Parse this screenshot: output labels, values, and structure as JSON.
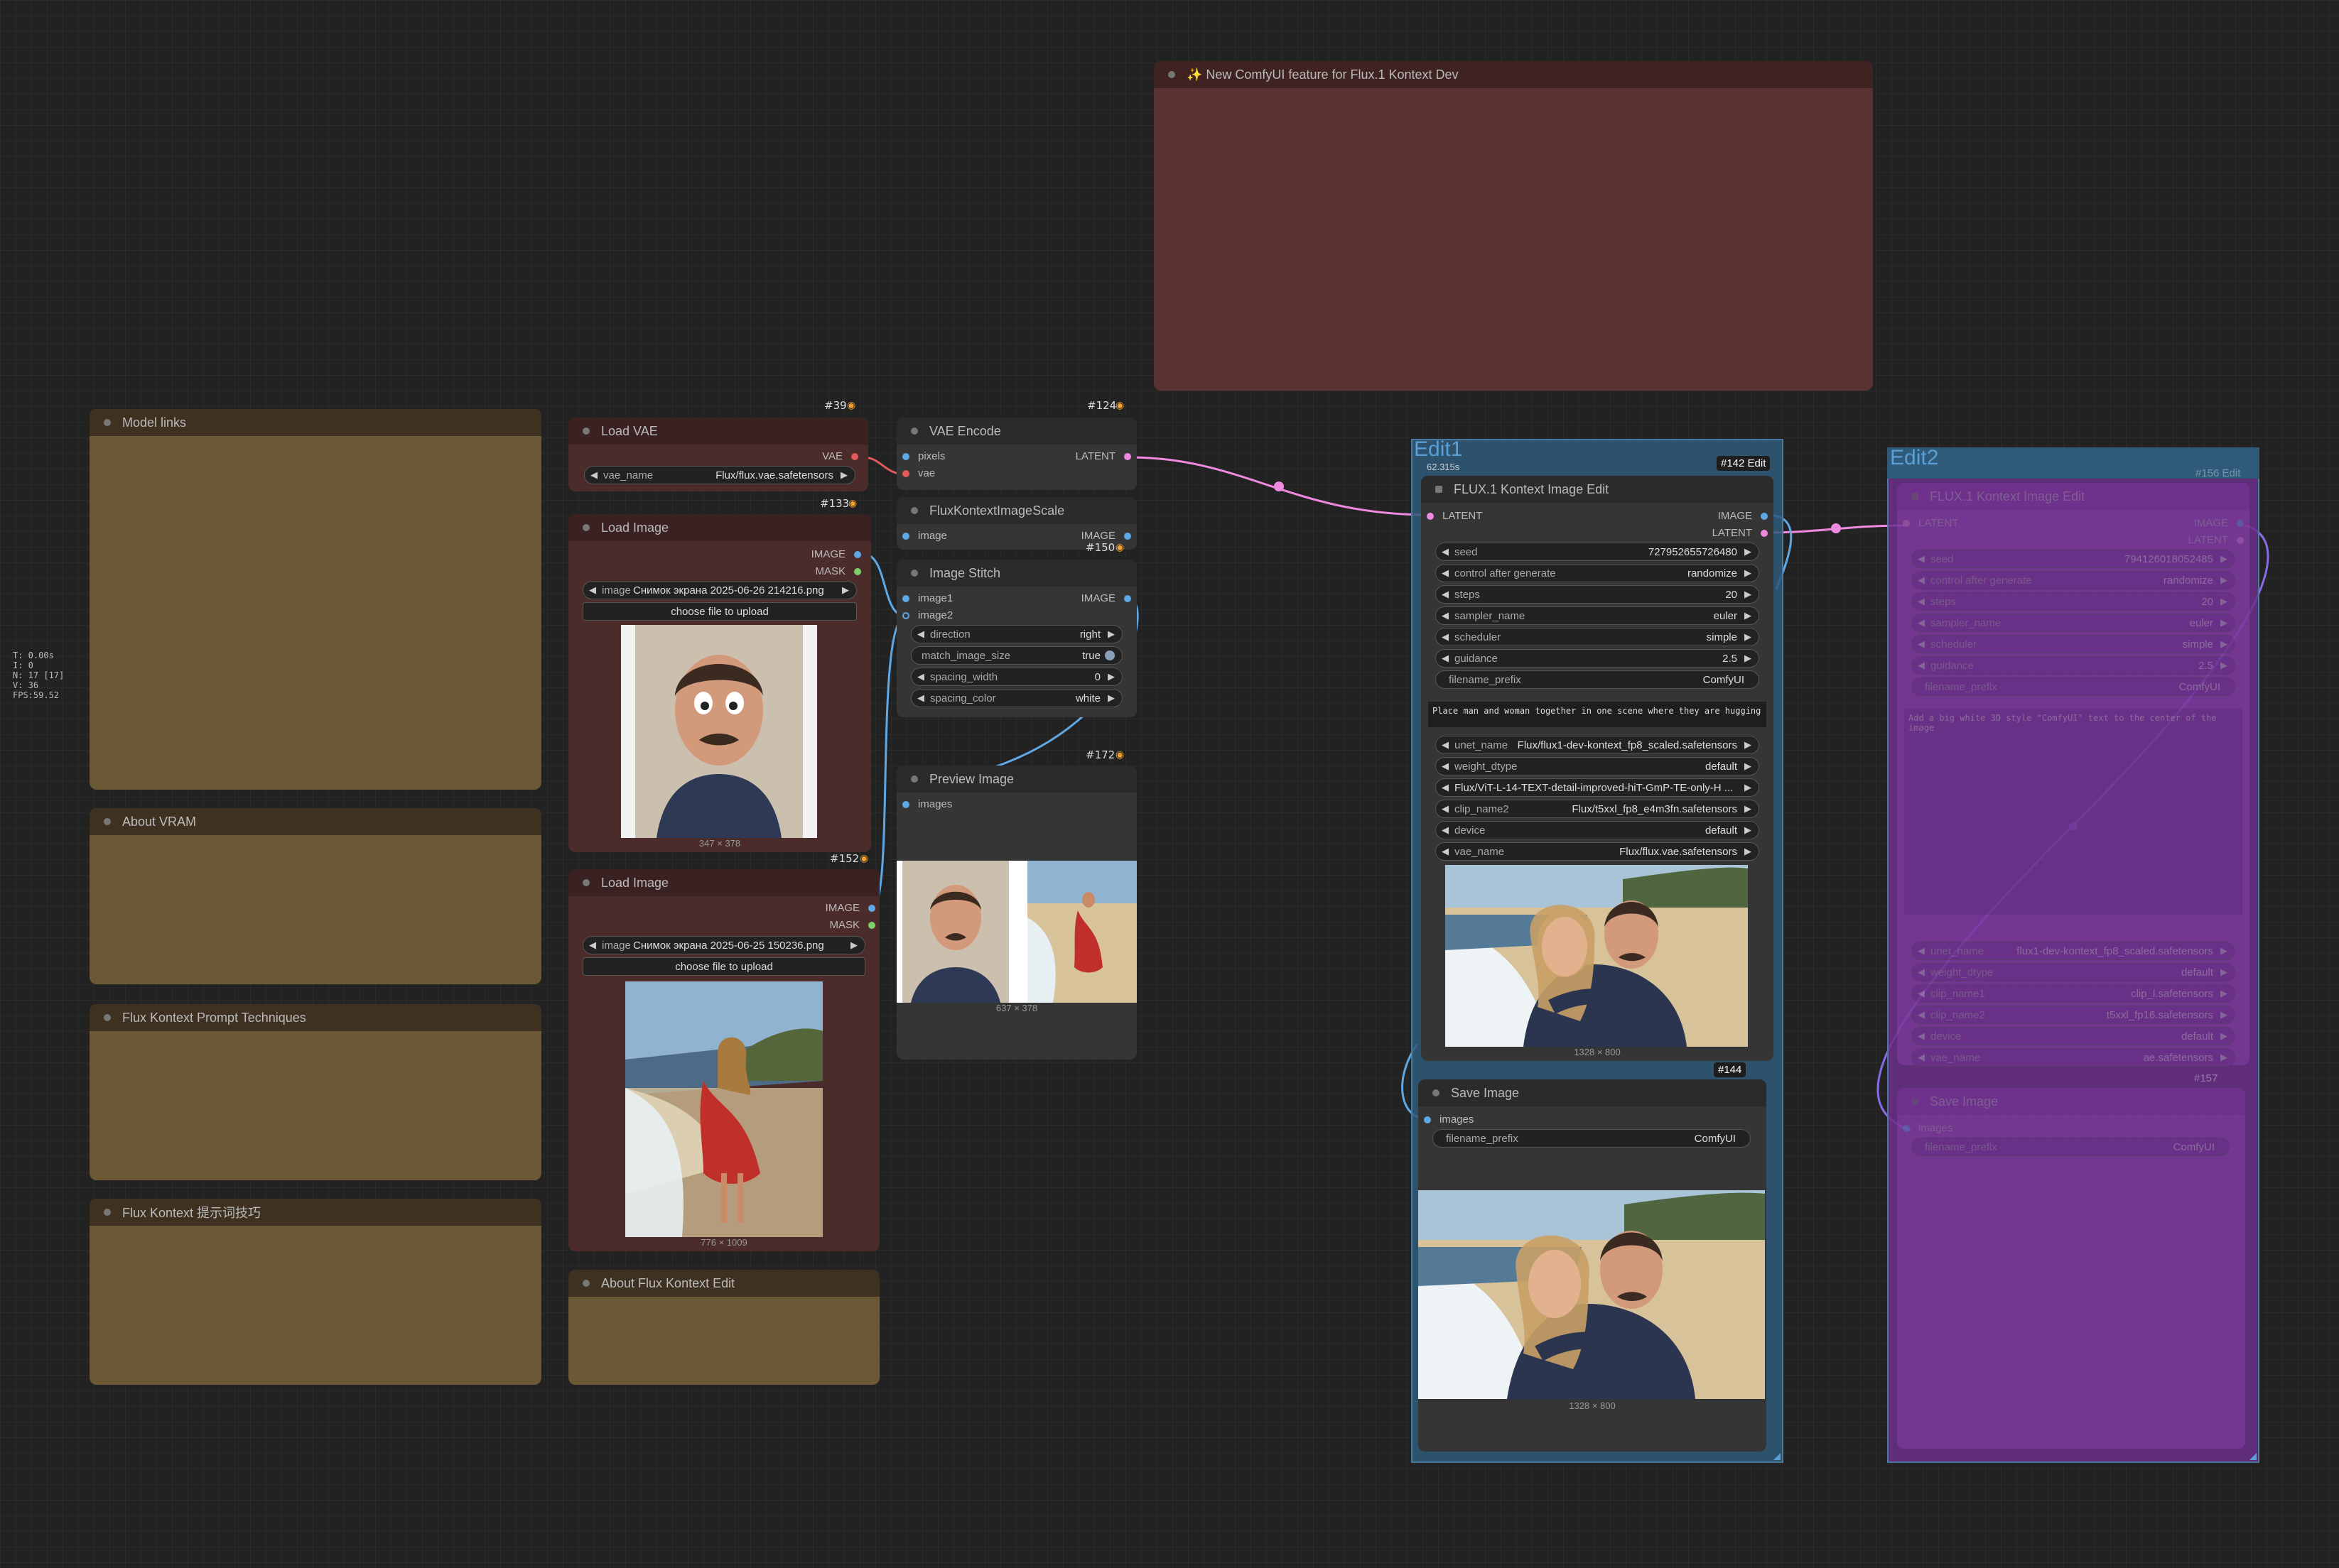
{
  "stats": [
    "T: 0.00s",
    "I: 0",
    "N: 17 [17]",
    "V: 36",
    "FPS:59.52"
  ],
  "notes": {
    "model_links": "Model links",
    "about_vram": "About VRAM",
    "prompt_techniques": "Flux Kontext Prompt Techniques",
    "prompt_techniques_cn": "Flux Kontext 提示词技巧",
    "about_edit": "About Flux Kontext Edit",
    "new_feature": "✨ New ComfyUI feature for Flux.1 Kontext Dev"
  },
  "load_vae": {
    "id": "#39",
    "title": "Load VAE",
    "out_vae": "VAE",
    "vae_name_label": "vae_name",
    "vae_name_value": "Flux/flux.vae.safetensors"
  },
  "load_image_1": {
    "id": "#133",
    "title": "Load Image",
    "out_image": "IMAGE",
    "out_mask": "MASK",
    "image_label": "image",
    "image_value": "Снимок экрана 2025-06-26 214216.png",
    "upload": "choose file to upload",
    "size": "347 × 378"
  },
  "load_image_2": {
    "id": "#152",
    "title": "Load Image",
    "out_image": "IMAGE",
    "out_mask": "MASK",
    "image_label": "image",
    "image_value": "Снимок экрана 2025-06-25 150236.png",
    "upload": "choose file to upload",
    "size": "776 × 1009"
  },
  "vae_encode": {
    "id": "#124",
    "title": "VAE Encode",
    "in_pixels": "pixels",
    "in_vae": "vae",
    "out_latent": "LATENT"
  },
  "scale": {
    "title": "FluxKontextImageScale",
    "in_image": "image",
    "out_image": "IMAGE"
  },
  "stitch": {
    "id": "#150",
    "title": "Image Stitch",
    "in_image1": "image1",
    "in_image2": "image2",
    "out_image": "IMAGE",
    "widgets": [
      {
        "label": "direction",
        "value": "right"
      },
      {
        "label": "match_image_size",
        "value": "true"
      },
      {
        "label": "spacing_width",
        "value": "0"
      },
      {
        "label": "spacing_color",
        "value": "white"
      }
    ]
  },
  "preview": {
    "id": "#172",
    "title": "Preview Image",
    "in_images": "images",
    "size": "637 × 378"
  },
  "edit1": {
    "group": "Edit1",
    "time": "62.315s",
    "id": "#142 Edit",
    "title": "FLUX.1 Kontext Image Edit",
    "in_latent": "LATENT",
    "out_image": "IMAGE",
    "out_latent": "LATENT",
    "widgets": [
      {
        "label": "seed",
        "value": "727952655726480"
      },
      {
        "label": "control after generate",
        "value": "randomize"
      },
      {
        "label": "steps",
        "value": "20"
      },
      {
        "label": "sampler_name",
        "value": "euler"
      },
      {
        "label": "scheduler",
        "value": "simple"
      },
      {
        "label": "guidance",
        "value": "2.5"
      }
    ],
    "prefix_label": "filename_prefix",
    "prefix_value": "ComfyUI",
    "prompt": "Place man and woman together in one scene where they are hugging",
    "widgets2": [
      {
        "label": "unet_name",
        "value": "Flux/flux1-dev-kontext_fp8_scaled.safetensors"
      },
      {
        "label": "weight_dtype",
        "value": "default"
      },
      {
        "label": "",
        "value": "Flux/ViT-L-14-TEXT-detail-improved-hiT-GmP-TE-only-H ..."
      },
      {
        "label": "clip_name2",
        "value": "Flux/t5xxl_fp8_e4m3fn.safetensors"
      },
      {
        "label": "device",
        "value": "default"
      },
      {
        "label": "vae_name",
        "value": "Flux/flux.vae.safetensors"
      }
    ],
    "size": "1328 × 800"
  },
  "save1": {
    "id": "#144",
    "title": "Save Image",
    "in_images": "images",
    "prefix_label": "filename_prefix",
    "prefix_value": "ComfyUI",
    "size": "1328 × 800"
  },
  "edit2": {
    "group": "Edit2",
    "id": "#156 Edit",
    "title": "FLUX.1 Kontext Image Edit",
    "in_latent": "LATENT",
    "out_image": "IMAGE",
    "out_latent": "LATENT",
    "widgets": [
      {
        "label": "seed",
        "value": "794126018052485"
      },
      {
        "label": "control after generate",
        "value": "randomize"
      },
      {
        "label": "steps",
        "value": "20"
      },
      {
        "label": "sampler_name",
        "value": "euler"
      },
      {
        "label": "scheduler",
        "value": "simple"
      },
      {
        "label": "guidance",
        "value": "2.5"
      }
    ],
    "prefix_label": "filename_prefix",
    "prefix_value": "ComfyUI",
    "prompt": "Add a big white 3D style \"ComfyUI\" text to the center of the image",
    "widgets2": [
      {
        "label": "unet_name",
        "value": "flux1-dev-kontext_fp8_scaled.safetensors"
      },
      {
        "label": "weight_dtype",
        "value": "default"
      },
      {
        "label": "clip_name1",
        "value": "clip_l.safetensors"
      },
      {
        "label": "clip_name2",
        "value": "t5xxl_fp16.safetensors"
      },
      {
        "label": "device",
        "value": "default"
      },
      {
        "label": "vae_name",
        "value": "ae.safetensors"
      }
    ]
  },
  "save2": {
    "id": "#157",
    "title": "Save Image",
    "in_images": "images",
    "prefix_label": "filename_prefix",
    "prefix_value": "ComfyUI"
  },
  "colors": {
    "latent_link": "#f08ae0",
    "image_link": "#5fa8e6",
    "vae_link": "#e05a5a",
    "group_blue": "#2f5a7a",
    "group_purple": "#6a2f8a"
  }
}
